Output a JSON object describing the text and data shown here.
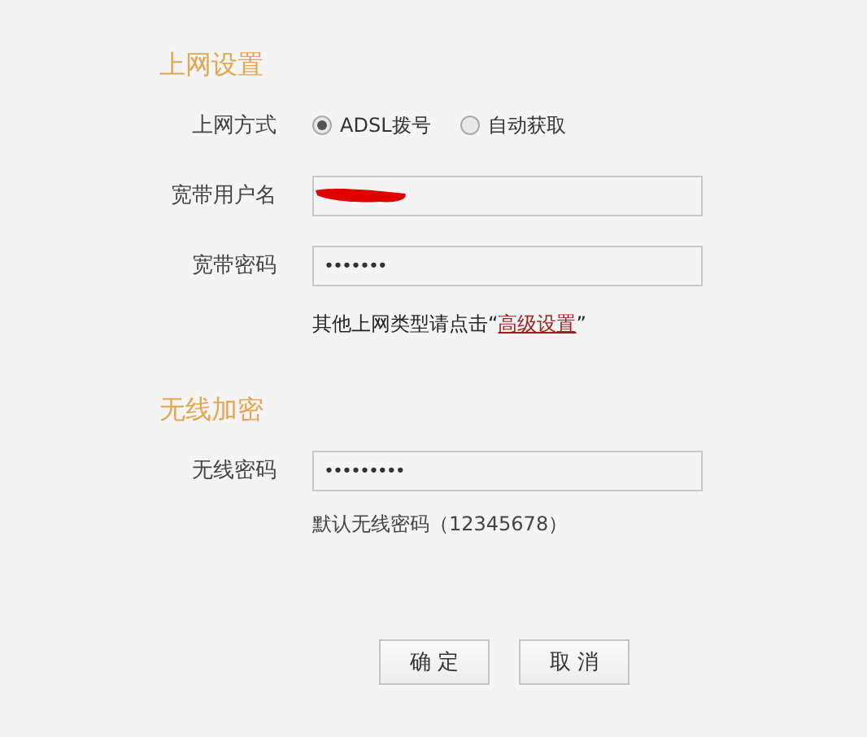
{
  "sections": [
    {
      "title": "上网设置",
      "rows": [
        {
          "kind": "radio",
          "label": "上网方式",
          "options": [
            {
              "label": "ADSL拨号",
              "selected": true
            },
            {
              "label": "自动获取",
              "selected": false
            }
          ]
        },
        {
          "kind": "field",
          "label": "宽带用户名",
          "redacted": true
        },
        {
          "kind": "field",
          "label": "宽带密码",
          "value": "•••••••"
        },
        {
          "kind": "note",
          "text_before": "其他上网类型请点击“",
          "link": "高级设置",
          "text_after": "”"
        }
      ]
    },
    {
      "title": "无线加密",
      "rows": [
        {
          "kind": "field",
          "label": "无线密码",
          "value": "•••••••••"
        },
        {
          "kind": "hint",
          "text": "默认无线密码（12345678）"
        }
      ]
    }
  ],
  "buttons": [
    "确 定",
    "取 消"
  ]
}
